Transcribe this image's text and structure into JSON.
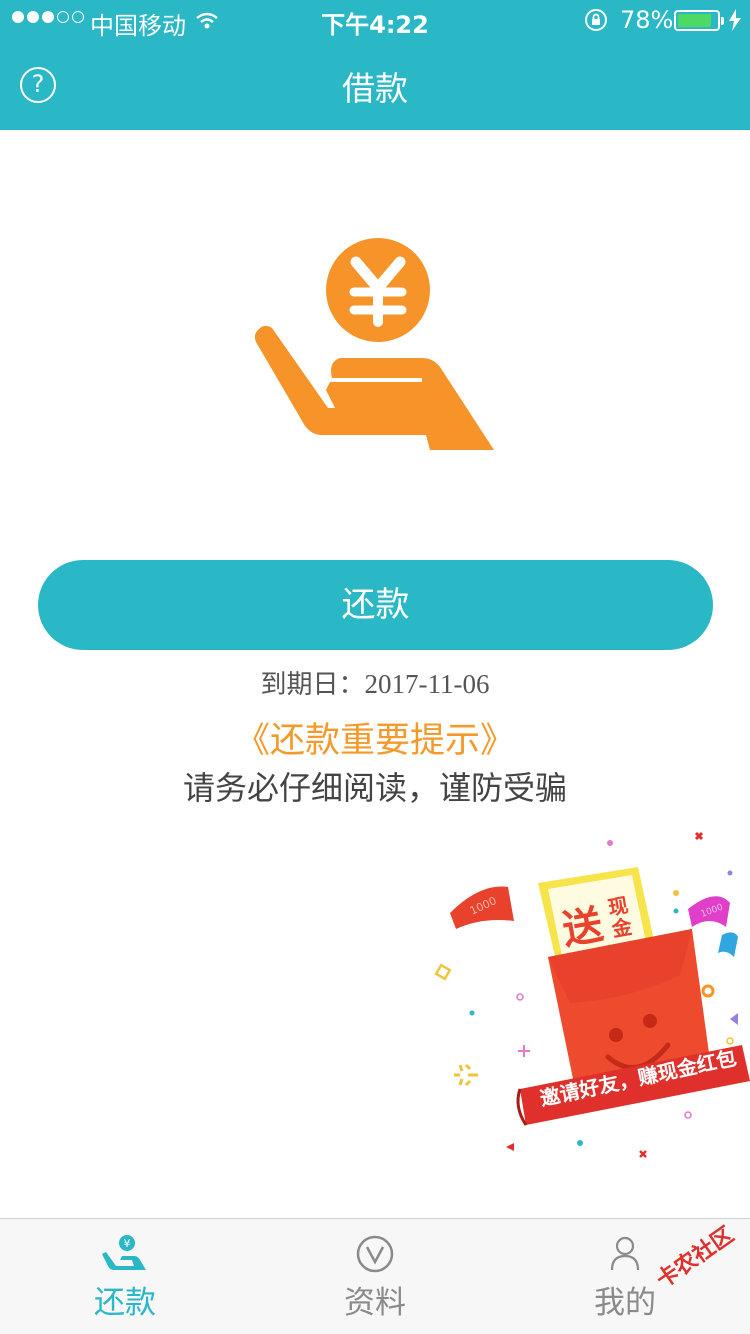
{
  "status_bar": {
    "carrier": "中国移动",
    "time": "下午4:22",
    "battery_percent": "78%",
    "battery_level": 0.78
  },
  "nav": {
    "help_icon": "?",
    "title": "借款"
  },
  "hero": {
    "icon": "hand-holding-yuan-coin-icon",
    "coin_symbol": "¥"
  },
  "repay_button": {
    "label": "还款"
  },
  "due": {
    "label": "到期日：",
    "value": "2017-11-06"
  },
  "notice_link": "《还款重要提示》",
  "warning": "请务必仔细阅读，谨防受骗",
  "promo": {
    "note_amount": "1000",
    "card_big": "送",
    "card_small": "现金",
    "banner": "邀请好友，赚现金红包"
  },
  "tabs": [
    {
      "label": "还款",
      "icon": "repay-hand-icon",
      "active": true
    },
    {
      "label": "资料",
      "icon": "v-circle-icon",
      "active": false
    },
    {
      "label": "我的",
      "icon": "user-icon",
      "active": false
    }
  ],
  "watermark": "卡农社区",
  "colors": {
    "accent": "#2ab7c6",
    "orange": "#f39a2a",
    "promo_red": "#e8412c"
  }
}
